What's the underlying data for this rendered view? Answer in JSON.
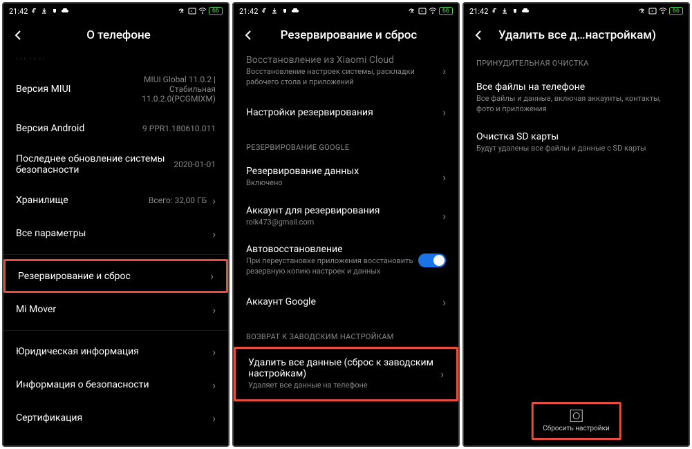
{
  "status": {
    "time": "21:42",
    "battery": "66"
  },
  "screen1": {
    "title": "О телефоне",
    "rows": {
      "miui": {
        "label": "Версия MIUI",
        "value": "MIUI Global 11.0.2 | Стабильная 11.0.2.0(PCGMIXM)"
      },
      "android": {
        "label": "Версия Android",
        "value": "9 PPR1.180610.011"
      },
      "security": {
        "label": "Последнее обновление системы безопасности",
        "value": "2020-01-01"
      },
      "storage": {
        "label": "Хранилище",
        "value": "Всего: 32,00 ГБ"
      },
      "allparams": {
        "label": "Все параметры"
      },
      "backup": {
        "label": "Резервирование и сброс"
      },
      "mimover": {
        "label": "Mi Mover"
      },
      "legal": {
        "label": "Юридическая информация"
      },
      "secinfo": {
        "label": "Информация о безопасности"
      },
      "cert": {
        "label": "Сертификация"
      }
    }
  },
  "screen2": {
    "title": "Резервирование и сброс",
    "xiaomi_cloud": {
      "label": "Восстановление из Xiaomi Cloud",
      "sub": "Восстановление настроек системы, раскладки рабочего стола и приложений"
    },
    "backup_settings": {
      "label": "Настройки резервирования"
    },
    "section_google": "РЕЗЕРВИРОВАНИЕ GOOGLE",
    "gbackup": {
      "label": "Резервирование данных",
      "sub": "Включено"
    },
    "gaccount": {
      "label": "Аккаунт для резервирования",
      "sub": "rolk473@gmail.com"
    },
    "autorestore": {
      "label": "Автовосстановление",
      "sub": "При переустановке приложения восстановить резервную копию настроек и данных"
    },
    "googleacc": {
      "label": "Аккаунт Google"
    },
    "section_factory": "ВОЗВРАТ К ЗАВОДСКИМ НАСТРОЙКАМ",
    "deleteall": {
      "label": "Удалить все данные (сброс к заводским настройкам)",
      "sub": "Удаляет все данные на телефоне"
    }
  },
  "screen3": {
    "title": "Удалить все д…настройкам)",
    "section": "ПРИНУДИТЕЛЬНАЯ ОЧИСТКА",
    "allfiles": {
      "label": "Все файлы на телефоне",
      "sub": "Все файлы и данные, включая аккаунты, контакты, фото и приложения"
    },
    "sdcard": {
      "label": "Очистка SD карты",
      "sub": "Будут удалены все файлы и данные с SD карты"
    },
    "action": "Сбросить настройки"
  }
}
